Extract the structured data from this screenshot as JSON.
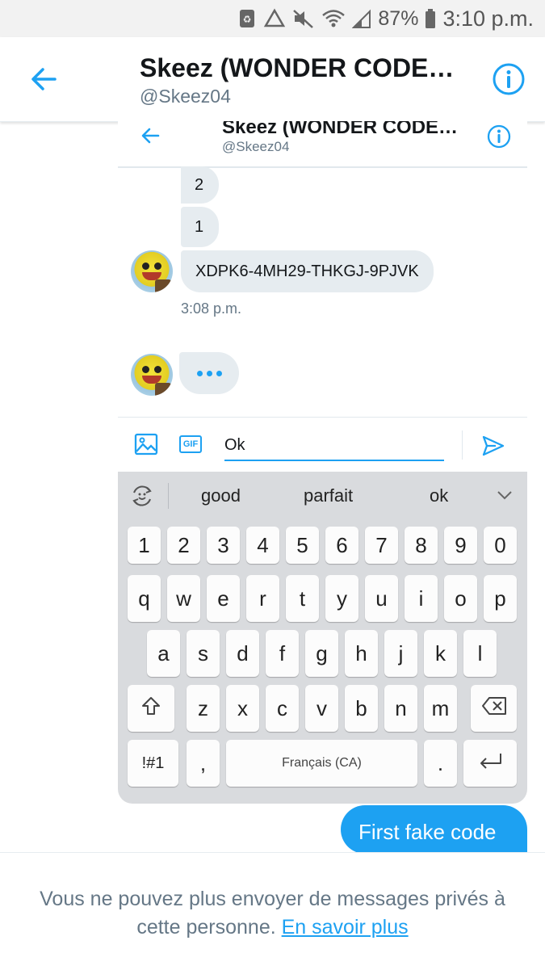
{
  "status_bar": {
    "battery_percent": "87%",
    "time": "3:10 p.m."
  },
  "header": {
    "title": "Skeez (WONDER CODE…",
    "handle": "@Skeez04"
  },
  "inner": {
    "header": {
      "title": "Skeez (WONDER CODE…",
      "handle": "@Skeez04"
    },
    "messages": [
      {
        "text": "2"
      },
      {
        "text": "1"
      },
      {
        "text": "XDPK6-4MH29-THKGJ-9PJVK"
      }
    ],
    "timestamp": "3:08 p.m.",
    "composer": {
      "gif_label": "GIF",
      "input_value": "Ok"
    },
    "keyboard": {
      "suggestions": [
        "good",
        "parfait",
        "ok"
      ],
      "row_numbers": [
        "1",
        "2",
        "3",
        "4",
        "5",
        "6",
        "7",
        "8",
        "9",
        "0"
      ],
      "row_top": [
        "q",
        "w",
        "e",
        "r",
        "t",
        "y",
        "u",
        "i",
        "o",
        "p"
      ],
      "row_middle": [
        "a",
        "s",
        "d",
        "f",
        "g",
        "h",
        "j",
        "k",
        "l"
      ],
      "row_bottom": [
        "z",
        "x",
        "c",
        "v",
        "b",
        "n",
        "m"
      ],
      "symbols_label": "!#1",
      "comma": ",",
      "space_label": "Français (CA)",
      "period": "."
    }
  },
  "sent_message": "First fake code",
  "footer": {
    "notice": "Vous ne pouvez plus envoyer de messages privés à cette personne.",
    "link": "En savoir plus"
  },
  "colors": {
    "accent": "#1da1f2",
    "bubble_received": "#e6ecf0",
    "secondary_text": "#657786"
  }
}
